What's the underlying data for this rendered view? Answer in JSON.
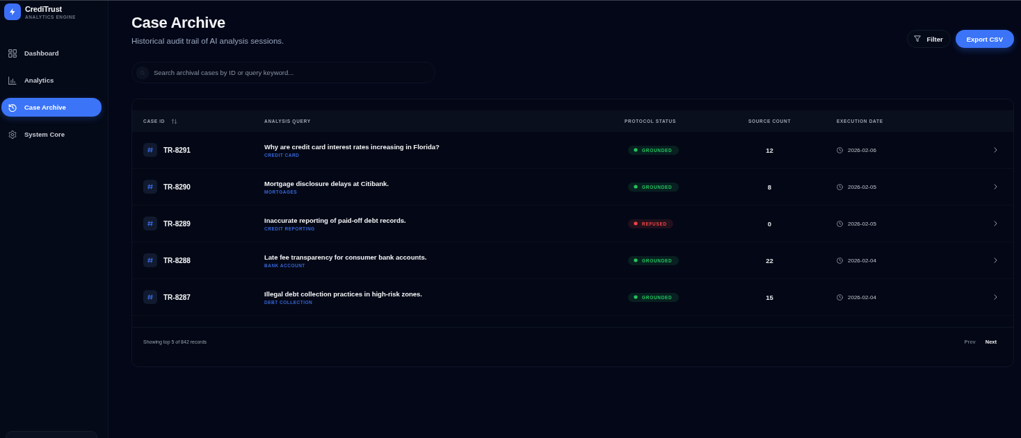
{
  "sidebar": {
    "brand": {
      "name": "CrediTrust",
      "tagline": "ANALYTICS ENGINE"
    },
    "items": [
      {
        "label": "Dashboard",
        "selected": false
      },
      {
        "label": "Analytics",
        "selected": false
      },
      {
        "label": "Case Archive",
        "selected": true
      },
      {
        "label": "System Core",
        "selected": false
      }
    ]
  },
  "header": {
    "title": "Case Archive",
    "subtitle": "Historical audit trail of AI analysis sessions."
  },
  "actions": [
    {
      "label": "Filter",
      "kind": "outline"
    },
    {
      "label": "Export CSV",
      "kind": "primary"
    }
  ],
  "search": {
    "placeholder": "Search archival cases by ID or query keyword..."
  },
  "table": {
    "columns": [
      {
        "label": "CASE ID",
        "sortable": true
      },
      {
        "label": "ANALYSIS QUERY",
        "sortable": false
      },
      {
        "label": "PROTOCOL STATUS",
        "sortable": false
      },
      {
        "label": "SOURCE COUNT",
        "sortable": false
      },
      {
        "label": "EXECUTION DATE",
        "sortable": false
      }
    ],
    "rows": [
      {
        "case_id": "TR-8291",
        "query": "Why are credit card interest rates increasing in Florida?",
        "tag": "CREDIT CARD",
        "status": "GROUNDED",
        "color": "#22c55e",
        "source_count": "12",
        "date": "2026-02-06"
      },
      {
        "case_id": "TR-8290",
        "query": "Mortgage disclosure delays at Citibank.",
        "tag": "MORTGAGES",
        "status": "GROUNDED",
        "color": "#22c55e",
        "source_count": "8",
        "date": "2026-02-05"
      },
      {
        "case_id": "TR-8289",
        "query": "Inaccurate reporting of paid-off debt records.",
        "tag": "CREDIT REPORTING",
        "status": "REFUSED",
        "color": "#ef4444",
        "source_count": "0",
        "date": "2026-02-05"
      },
      {
        "case_id": "TR-8288",
        "query": "Late fee transparency for consumer bank accounts.",
        "tag": "BANK ACCOUNT",
        "status": "GROUNDED",
        "color": "#22c55e",
        "source_count": "22",
        "date": "2026-02-04"
      },
      {
        "case_id": "TR-8287",
        "query": "Illegal debt collection practices in high-risk zones.",
        "tag": "DEBT COLLECTION",
        "status": "GROUNDED",
        "color": "#22c55e",
        "source_count": "15",
        "date": "2026-02-04"
      }
    ]
  },
  "footer": {
    "summary": "Showing top 5 of 842 records",
    "pages": [
      {
        "label": "Prev",
        "disabled": true
      },
      {
        "label": "Next",
        "disabled": false
      }
    ]
  }
}
